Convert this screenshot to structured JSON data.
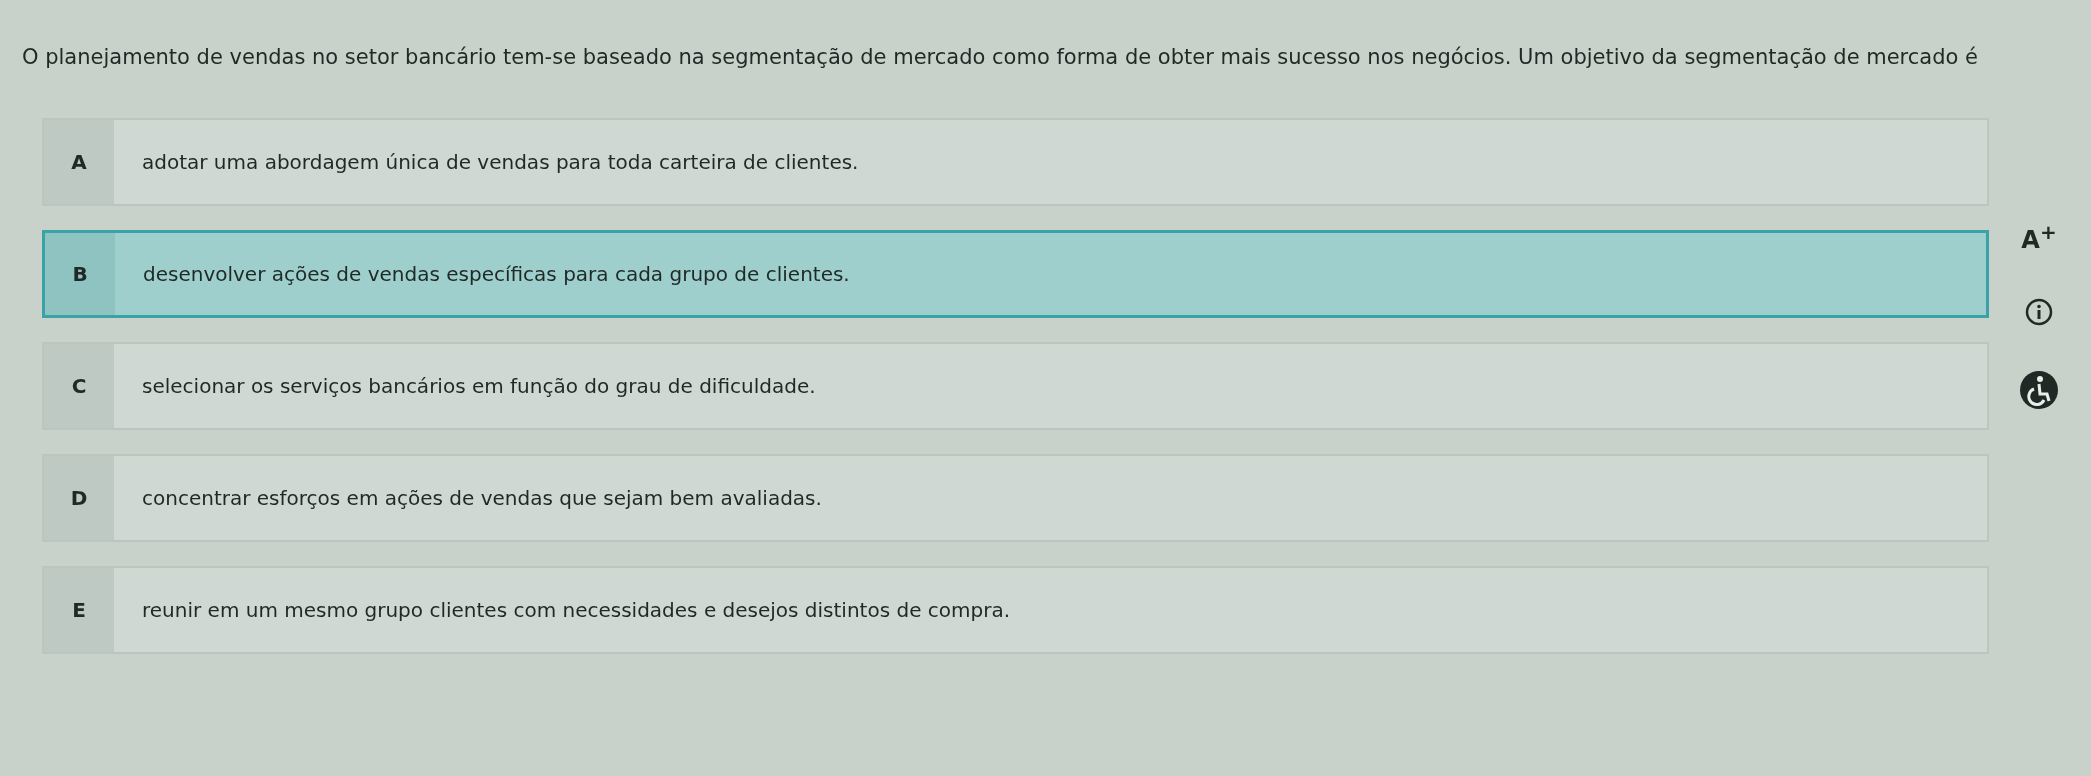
{
  "question": "O planejamento de vendas no setor bancário tem-se baseado na segmentação de mercado como forma de obter mais sucesso nos negócios. Um objetivo da segmentação de mercado é",
  "options": [
    {
      "letter": "A",
      "text": "adotar uma abordagem única de vendas para toda carteira de clientes.",
      "selected": false
    },
    {
      "letter": "B",
      "text": "desenvolver ações de vendas específicas para cada grupo de clientes.",
      "selected": true
    },
    {
      "letter": "C",
      "text": "selecionar os serviços bancários em função do grau de dificuldade.",
      "selected": false
    },
    {
      "letter": "D",
      "text": "concentrar esforços em ações de vendas que sejam bem avaliadas.",
      "selected": false
    },
    {
      "letter": "E",
      "text": "reunir em um mesmo grupo clientes com necessidades e desejos distintos de compra.",
      "selected": false
    }
  ],
  "font_size_button": "A$^{+}$"
}
